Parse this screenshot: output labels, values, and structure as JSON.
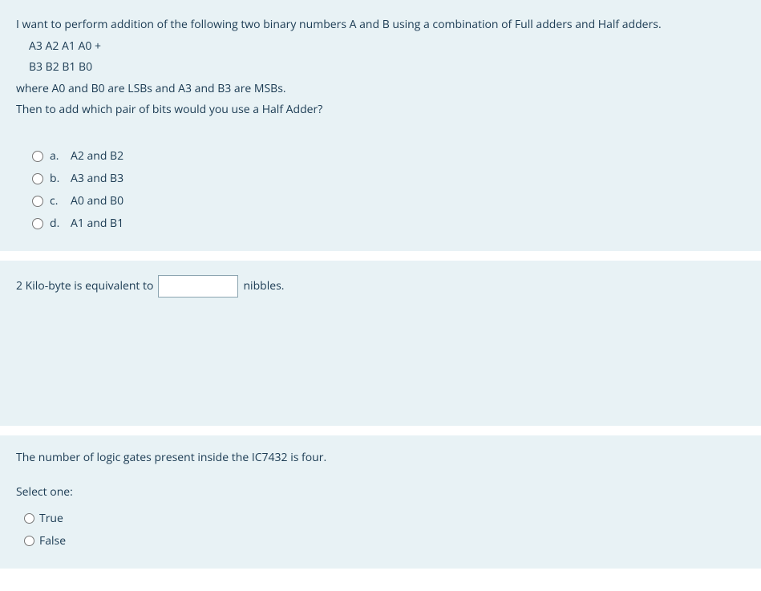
{
  "q1": {
    "line1": "I want to perform addition of the following two binary numbers A and B  using a combination of  Full adders and Half adders.",
    "line2": "A3 A2 A1 A0  +",
    "line3": "B3 B2 B1 B0",
    "line4": "where A0 and B0 are LSBs and A3 and B3 are MSBs.",
    "line5": "Then  to add which pair of bits would you use a Half Adder?",
    "options": {
      "a": {
        "letter": "a.",
        "text": "A2 and B2"
      },
      "b": {
        "letter": "b.",
        "text": "A3 and B3"
      },
      "c": {
        "letter": "c.",
        "text": "A0 and B0"
      },
      "d": {
        "letter": "d.",
        "text": "A1 and B1"
      }
    }
  },
  "q2": {
    "before": "2 Kilo-byte is equivalent to",
    "after": "nibbles.",
    "value": ""
  },
  "q3": {
    "prompt": "The number of logic gates present inside the IC7432 is four.",
    "select_label": "Select one:",
    "opt_true": "True",
    "opt_false": "False"
  }
}
